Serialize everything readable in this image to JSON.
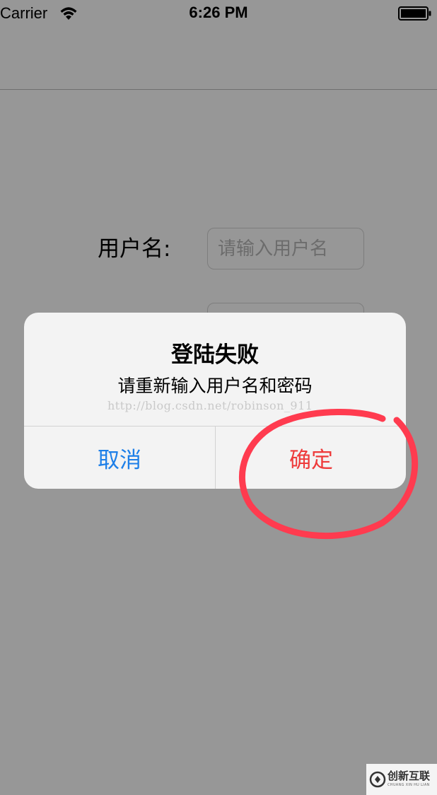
{
  "status_bar": {
    "carrier": "Carrier",
    "time": "6:26 PM",
    "wifi_icon": "wifi-icon",
    "battery_icon": "battery-icon"
  },
  "form": {
    "username_label": "用户名:",
    "username_placeholder": "请输入用户名",
    "username_value": "",
    "password_value": ""
  },
  "alert": {
    "title": "登陆失败",
    "message": "请重新输入用户名和密码",
    "cancel_label": "取消",
    "confirm_label": "确定"
  },
  "watermark": "http://blog.csdn.net/robinson_911",
  "logo": {
    "text": "创新互联",
    "subtext": "CHUANG XIN HU LIAN"
  },
  "colors": {
    "background": "#979797",
    "cancel": "#1d7fe8",
    "confirm": "#ee3b3b",
    "annotation": "#ff3b4f"
  }
}
